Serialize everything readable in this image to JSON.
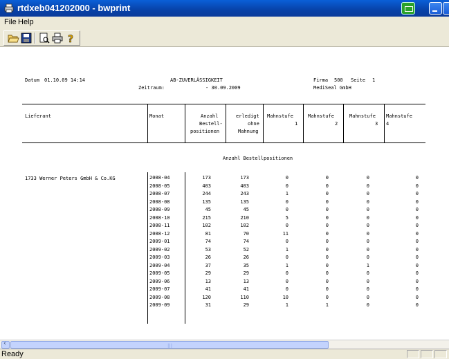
{
  "window": {
    "title": "rtdxeb041202000 - bwprint"
  },
  "menu": {
    "file": "File",
    "help": "Help"
  },
  "toolbar": {
    "open": "open-icon",
    "save": "save-icon",
    "preview": "print-preview-icon",
    "print": "printer-icon",
    "help": "help-icon"
  },
  "report": {
    "datum_label": "Datum",
    "datum_value": "01.10.09 14:14",
    "report_title": "AB-ZUVERLÄSSIGKEIT",
    "zeitraum_label": "Zeitraum:",
    "zeitraum_value": "- 30.09.2009",
    "firma_label": "Firma",
    "firma_value": "500",
    "seite_label": "Seite",
    "seite_value": "1",
    "company": "MediSeal GmbH",
    "columns": {
      "lieferant": "Lieferant",
      "monat": "Monat",
      "anzahl_1": "Anzahl",
      "anzahl_2": "Bestell-",
      "anzahl_3": "positionen",
      "erledigt_1": "erledigt",
      "erledigt_2": "ohne",
      "erledigt_3": "Mahnung",
      "ms1_1": "Mahnstufe",
      "ms1_2": "1",
      "ms2_1": "Mahnstufe",
      "ms2_2": "2",
      "ms3_1": "Mahnstufe",
      "ms3_2": "3",
      "ms4_1": "Mahnstufe",
      "ms4_2": "4"
    },
    "section_title": "Anzahl Bestellpositionen",
    "supplier": "1733 Werner Peters GmbH & Co.KG",
    "rows": [
      [
        "2008-04",
        "173",
        "173",
        "0",
        "0",
        "0",
        "0"
      ],
      [
        "2008-05",
        "403",
        "403",
        "0",
        "0",
        "0",
        "0"
      ],
      [
        "2008-07",
        "244",
        "243",
        "1",
        "0",
        "0",
        "0"
      ],
      [
        "2008-08",
        "135",
        "135",
        "0",
        "0",
        "0",
        "0"
      ],
      [
        "2008-09",
        "45",
        "45",
        "0",
        "0",
        "0",
        "0"
      ],
      [
        "2008-10",
        "215",
        "210",
        "5",
        "0",
        "0",
        "0"
      ],
      [
        "2008-11",
        "102",
        "102",
        "0",
        "0",
        "0",
        "0"
      ],
      [
        "2008-12",
        "81",
        "70",
        "11",
        "0",
        "0",
        "0"
      ],
      [
        "2009-01",
        "74",
        "74",
        "0",
        "0",
        "0",
        "0"
      ],
      [
        "2009-02",
        "53",
        "52",
        "1",
        "0",
        "0",
        "0"
      ],
      [
        "2009-03",
        "26",
        "26",
        "0",
        "0",
        "0",
        "0"
      ],
      [
        "2009-04",
        "37",
        "35",
        "1",
        "0",
        "1",
        "0"
      ],
      [
        "2009-05",
        "29",
        "29",
        "0",
        "0",
        "0",
        "0"
      ],
      [
        "2009-06",
        "13",
        "13",
        "0",
        "0",
        "0",
        "0"
      ],
      [
        "2009-07",
        "41",
        "41",
        "0",
        "0",
        "0",
        "0"
      ],
      [
        "2009-08",
        "120",
        "110",
        "10",
        "0",
        "0",
        "0"
      ],
      [
        "2009-09",
        "31",
        "29",
        "1",
        "1",
        "0",
        "0"
      ]
    ]
  },
  "scrollbar": {
    "grip": "|||"
  },
  "status": {
    "text": "Ready"
  }
}
